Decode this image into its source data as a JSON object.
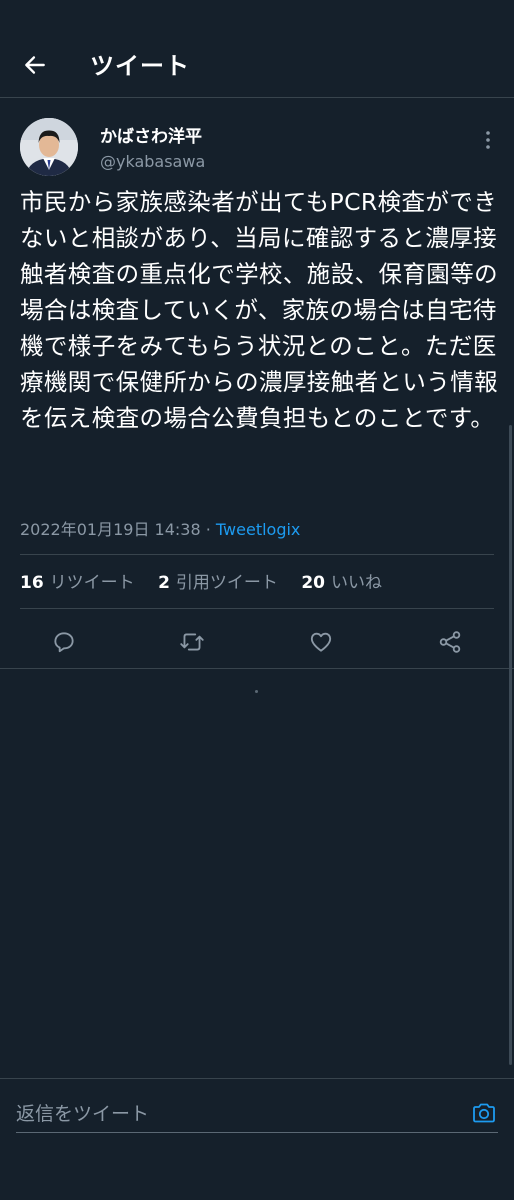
{
  "header": {
    "back_icon": "arrow-left-icon",
    "title": "ツイート"
  },
  "tweet": {
    "author": {
      "name": "かばさわ洋平",
      "handle": "@ykabasawa",
      "avatar_icon": "profile-photo"
    },
    "text": "市民から家族感染者が出てもPCR検査ができないと相談があり、当局に確認すると濃厚接触者検査の重点化で学校、施設、保育園等の場合は検査していくが、家族の場合は自宅待機で様子をみてもらう状況とのこと。ただ医療機関で保健所からの濃厚接触者という情報を伝え検査の場合公費負担もとのことです。",
    "timestamp": "2022年01月19日 14:38",
    "separator": "·",
    "client": "Tweetlogix",
    "stats": {
      "retweets_count": "16",
      "retweets_label": "リツイート",
      "quotes_count": "2",
      "quotes_label": "引用ツイート",
      "likes_count": "20",
      "likes_label": "いいね"
    },
    "actions": [
      "reply-icon",
      "retweet-icon",
      "like-icon",
      "share-icon"
    ]
  },
  "reply_bar": {
    "placeholder": "返信をツイート",
    "camera_icon": "camera-icon"
  },
  "colors": {
    "background": "#15202b",
    "border": "#38444d",
    "secondary_text": "#8b98a5",
    "accent": "#1d9bf0"
  }
}
